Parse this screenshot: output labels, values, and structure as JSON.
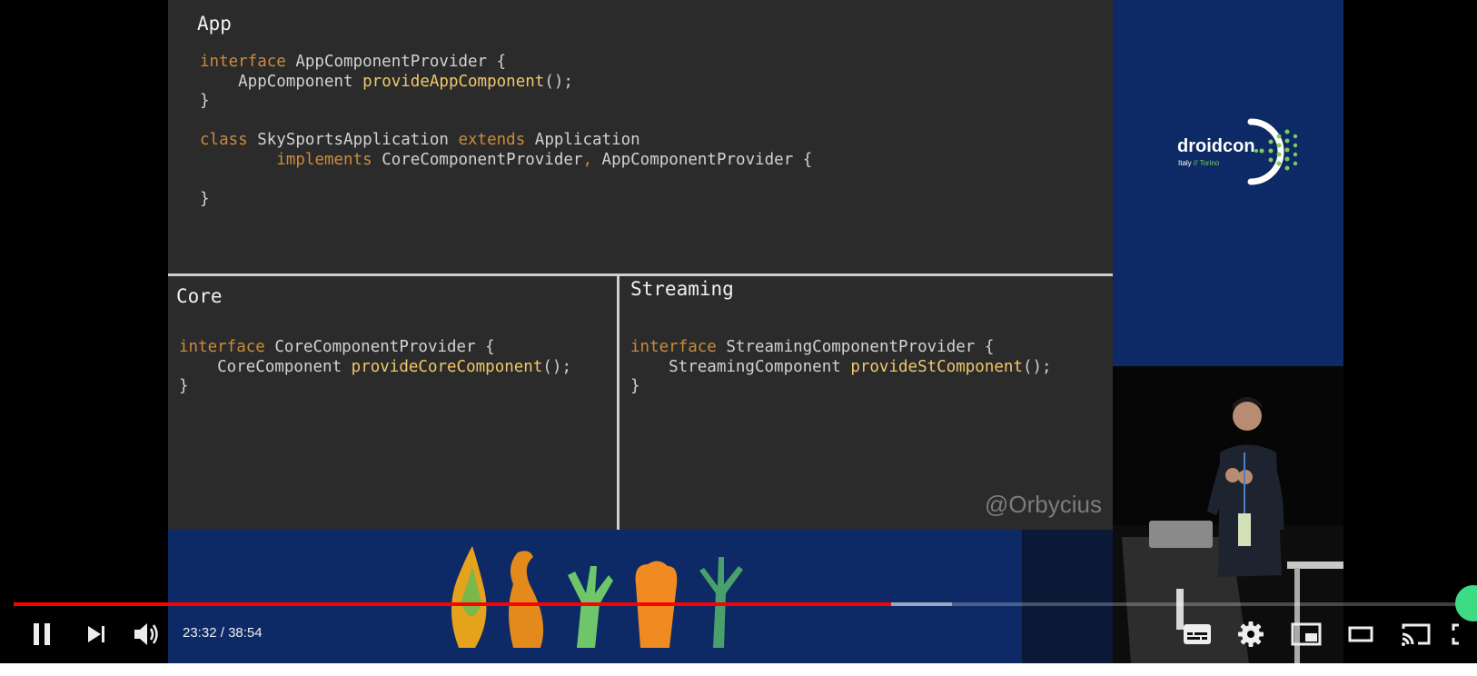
{
  "slide": {
    "app": {
      "title": "App",
      "line1_kw": "interface",
      "line1_rest": " AppComponentProvider {",
      "line2_type": "    AppComponent ",
      "line2_fn": "provideAppComponent",
      "line2_end": "();",
      "line3": "}",
      "line5_kw": "class",
      "line5_mid": " SkySportsApplication ",
      "line5_kw2": "extends",
      "line5_end": " Application",
      "line6_pad": "        ",
      "line6_kw": "implements",
      "line6_rest": " CoreComponentProvider",
      "line6_comma": ",",
      "line6_end": " AppComponentProvider {",
      "line8": "}"
    },
    "core": {
      "title": "Core",
      "line1_kw": "interface",
      "line1_rest": " CoreComponentProvider {",
      "line2_type": "    CoreComponent ",
      "line2_fn": "provideCoreComponent",
      "line2_end": "();",
      "line3": "}"
    },
    "streaming": {
      "title": "Streaming",
      "line1_kw": "interface",
      "line1_rest": " StreamingComponentProvider {",
      "line2_type": "    StreamingComponent ",
      "line2_fn": "provideStComponent",
      "line2_end": "();",
      "line3": "}"
    },
    "handle": "@Orbycius"
  },
  "brand": {
    "name": "droidcon",
    "sub_left": "Italy ",
    "sub_sep": "//",
    "sub_right": " Torino"
  },
  "player": {
    "current_time": "23:32",
    "separator": " / ",
    "duration": "38:54",
    "played_fraction": 0.605,
    "buffered_fraction": 0.647,
    "accent_color": "#ff0000",
    "icons": [
      "pause-icon",
      "next-icon",
      "volume-icon",
      "subtitles-icon",
      "settings-icon",
      "miniplayer-icon",
      "theater-icon",
      "cast-icon",
      "fullscreen-icon"
    ]
  }
}
